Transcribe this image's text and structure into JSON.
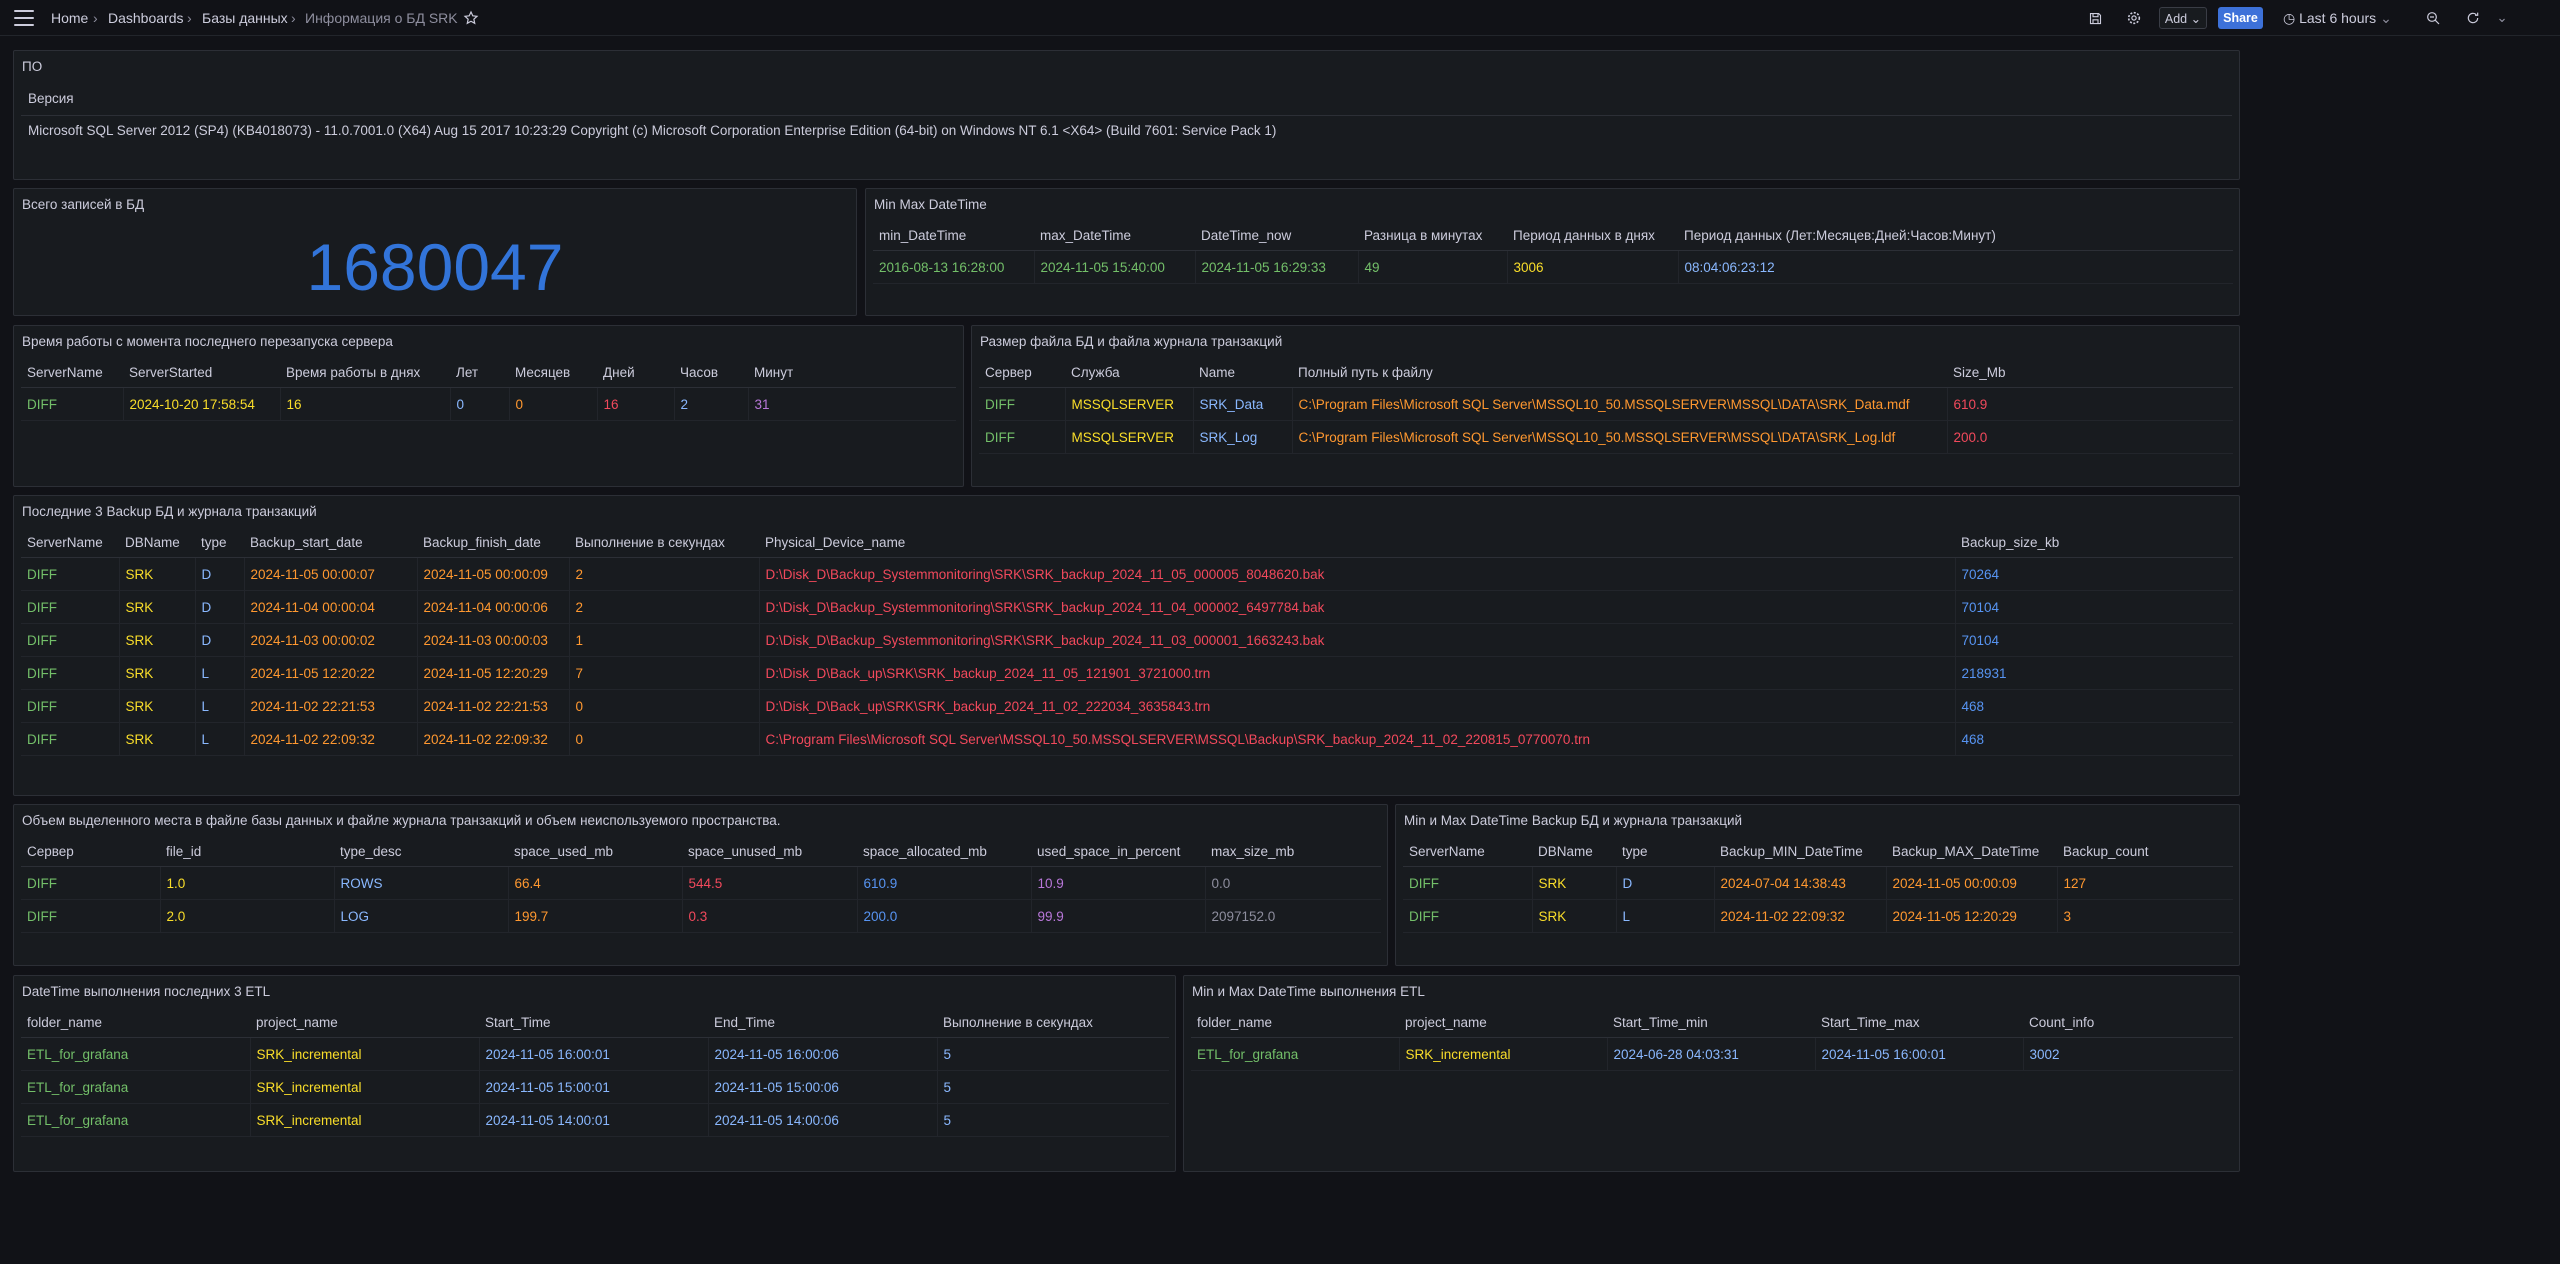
{
  "breadcrumbs": {
    "home": "Home",
    "dashboards": "Dashboards",
    "folder": "Базы данных",
    "current": "Информация о БД SRK"
  },
  "toolbar": {
    "add_label": "Add",
    "share_label": "Share",
    "time_range": "Last 6 hours"
  },
  "panel_po": {
    "title": "ПО",
    "column": "Версия",
    "value": "Microsoft SQL Server 2012 (SP4) (KB4018073) - 11.0.7001.0 (X64) Aug 15 2017 10:23:29 Copyright (c) Microsoft Corporation Enterprise Edition (64-bit) on Windows NT 6.1 <X64> (Build 7601: Service Pack 1)"
  },
  "panel_total": {
    "title": "Всего записей в БД",
    "value": "1680047"
  },
  "panel_minmax": {
    "title": "Min Max DateTime",
    "headers": [
      "min_DateTime",
      "max_DateTime",
      "DateTime_now",
      "Разница в минутах",
      "Период данных в днях",
      "Период данных (Лет:Месяцев:Дней:Часов:Минут)"
    ],
    "row": [
      "2016-08-13 16:28:00",
      "2024-11-05 15:40:00",
      "2024-11-05 16:29:33",
      "49",
      "3006",
      "08:04:06:23:12"
    ]
  },
  "panel_uptime": {
    "title": "Время работы с момента последнего перезапуска сервера",
    "headers": [
      "ServerName",
      "ServerStarted",
      "Время работы в днях",
      "Лет",
      "Месяцев",
      "Дней",
      "Часов",
      "Минут"
    ],
    "row": [
      "DIFF",
      "2024-10-20 17:58:54",
      "16",
      "0",
      "0",
      "16",
      "2",
      "31"
    ]
  },
  "panel_filesize": {
    "title": "Размер файла БД и файла журнала транзакций",
    "headers": [
      "Сервер",
      "Служба",
      "Name",
      "Полный путь к файлу",
      "Size_Mb"
    ],
    "rows": [
      [
        "DIFF",
        "MSSQLSERVER",
        "SRK_Data",
        "C:\\Program Files\\Microsoft SQL Server\\MSSQL10_50.MSSQLSERVER\\MSSQL\\DATA\\SRK_Data.mdf",
        "610.9"
      ],
      [
        "DIFF",
        "MSSQLSERVER",
        "SRK_Log",
        "C:\\Program Files\\Microsoft SQL Server\\MSSQL10_50.MSSQLSERVER\\MSSQL\\DATA\\SRK_Log.ldf",
        "200.0"
      ]
    ]
  },
  "panel_backup": {
    "title": "Последние 3 Backup БД и журнала транзакций",
    "headers": [
      "ServerName",
      "DBName",
      "type",
      "Backup_start_date",
      "Backup_finish_date",
      "Выполнение в секундах",
      "Physical_Device_name",
      "Backup_size_kb"
    ],
    "rows": [
      [
        "DIFF",
        "SRK",
        "D",
        "2024-11-05 00:00:07",
        "2024-11-05 00:00:09",
        "2",
        "D:\\Disk_D\\Backup_Systemmonitoring\\SRK\\SRK_backup_2024_11_05_000005_8048620.bak",
        "70264"
      ],
      [
        "DIFF",
        "SRK",
        "D",
        "2024-11-04 00:00:04",
        "2024-11-04 00:00:06",
        "2",
        "D:\\Disk_D\\Backup_Systemmonitoring\\SRK\\SRK_backup_2024_11_04_000002_6497784.bak",
        "70104"
      ],
      [
        "DIFF",
        "SRK",
        "D",
        "2024-11-03 00:00:02",
        "2024-11-03 00:00:03",
        "1",
        "D:\\Disk_D\\Backup_Systemmonitoring\\SRK\\SRK_backup_2024_11_03_000001_1663243.bak",
        "70104"
      ],
      [
        "DIFF",
        "SRK",
        "L",
        "2024-11-05 12:20:22",
        "2024-11-05 12:20:29",
        "7",
        "D:\\Disk_D\\Back_up\\SRK\\SRK_backup_2024_11_05_121901_3721000.trn",
        "218931"
      ],
      [
        "DIFF",
        "SRK",
        "L",
        "2024-11-02 22:21:53",
        "2024-11-02 22:21:53",
        "0",
        "D:\\Disk_D\\Back_up\\SRK\\SRK_backup_2024_11_02_222034_3635843.trn",
        "468"
      ],
      [
        "DIFF",
        "SRK",
        "L",
        "2024-11-02 22:09:32",
        "2024-11-02 22:09:32",
        "0",
        "C:\\Program Files\\Microsoft SQL Server\\MSSQL10_50.MSSQLSERVER\\MSSQL\\Backup\\SRK_backup_2024_11_02_220815_0770070.trn",
        "468"
      ]
    ]
  },
  "panel_space": {
    "title": "Объем выделенного места в файле базы данных и файле журнала транзакций и объем неиспользуемого пространства.",
    "headers": [
      "Сервер",
      "file_id",
      "type_desc",
      "space_used_mb",
      "space_unused_mb",
      "space_allocated_mb",
      "used_space_in_percent",
      "max_size_mb"
    ],
    "rows": [
      [
        "DIFF",
        "1.0",
        "ROWS",
        "66.4",
        "544.5",
        "610.9",
        "10.9",
        "0.0"
      ],
      [
        "DIFF",
        "2.0",
        "LOG",
        "199.7",
        "0.3",
        "200.0",
        "99.9",
        "2097152.0"
      ]
    ]
  },
  "panel_backup_minmax": {
    "title": "Min и Max DateTime Backup БД и журнала транзакций",
    "headers": [
      "ServerName",
      "DBName",
      "type",
      "Backup_MIN_DateTime",
      "Backup_MAX_DateTime",
      "Backup_count"
    ],
    "rows": [
      [
        "DIFF",
        "SRK",
        "D",
        "2024-07-04 14:38:43",
        "2024-11-05 00:00:09",
        "127"
      ],
      [
        "DIFF",
        "SRK",
        "L",
        "2024-11-02 22:09:32",
        "2024-11-05 12:20:29",
        "3"
      ]
    ]
  },
  "panel_etl": {
    "title": "DateTime выполнения последних 3 ETL",
    "headers": [
      "folder_name",
      "project_name",
      "Start_Time",
      "End_Time",
      "Выполнение в секундах"
    ],
    "rows": [
      [
        "ETL_for_grafana",
        "SRK_incremental",
        "2024-11-05 16:00:01",
        "2024-11-05 16:00:06",
        "5"
      ],
      [
        "ETL_for_grafana",
        "SRK_incremental",
        "2024-11-05 15:00:01",
        "2024-11-05 15:00:06",
        "5"
      ],
      [
        "ETL_for_grafana",
        "SRK_incremental",
        "2024-11-05 14:00:01",
        "2024-11-05 14:00:06",
        "5"
      ]
    ]
  },
  "panel_etl_minmax": {
    "title": "Min и Max DateTime выполнения ETL",
    "headers": [
      "folder_name",
      "project_name",
      "Start_Time_min",
      "Start_Time_max",
      "Count_info"
    ],
    "row": [
      "ETL_for_grafana",
      "SRK_incremental",
      "2024-06-28 04:03:31",
      "2024-11-05 16:00:01",
      "3002"
    ]
  },
  "icons": [
    "menu-icon",
    "chevron-right-icon",
    "star-icon",
    "save-icon",
    "gear-icon",
    "chevron-down-icon",
    "clock-icon",
    "zoom-out-icon",
    "refresh-icon"
  ],
  "colors": {
    "background": "#111217",
    "panel": "#181b1f",
    "green": "#73bf69",
    "yellow": "#fade2a",
    "orange": "#ff9830",
    "red": "#f2495c",
    "blue": "#8ab8ff",
    "purple": "#b877d9",
    "share": "#3d71d9",
    "stat": "#3274d9"
  }
}
